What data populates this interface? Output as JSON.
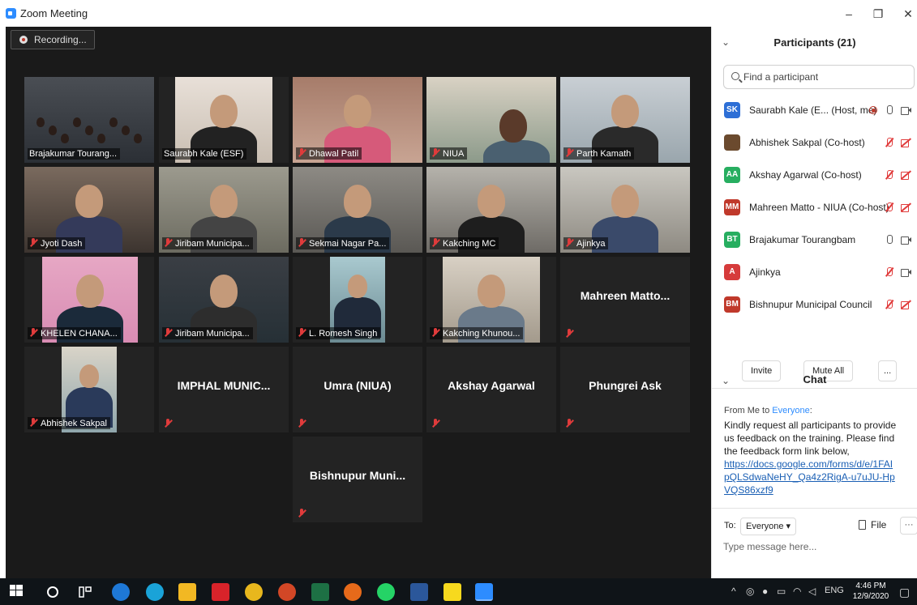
{
  "window": {
    "title": "Zoom Meeting",
    "minimize": "–",
    "restore": "❐",
    "close": "✕"
  },
  "recording_label": "Recording...",
  "tiles": [
    {
      "name": "Brajakumar Tourang...",
      "muted": false,
      "video": true
    },
    {
      "name": "Saurabh Kale (ESF)",
      "muted": false,
      "video": true
    },
    {
      "name": "Dhawal Patil",
      "muted": true,
      "video": true
    },
    {
      "name": "NIUA",
      "muted": true,
      "video": true
    },
    {
      "name": "Parth Kamath",
      "muted": true,
      "video": true
    },
    {
      "name": "Jyoti Dash",
      "muted": true,
      "video": true
    },
    {
      "name": "Jiribam Municipa...",
      "muted": true,
      "video": true
    },
    {
      "name": "Sekmai Nagar Pa...",
      "muted": true,
      "video": true
    },
    {
      "name": "Kakching MC",
      "muted": true,
      "video": true
    },
    {
      "name": "Ajinkya",
      "muted": true,
      "video": true
    },
    {
      "name": "KHELEN CHANA...",
      "muted": true,
      "video": true
    },
    {
      "name": "Jiribam Municipa...",
      "muted": true,
      "video": true
    },
    {
      "name": "L. Romesh Singh",
      "muted": true,
      "video": true
    },
    {
      "name": "Kakching Khunou...",
      "muted": true,
      "video": true
    },
    {
      "name": "Mahreen Matto...",
      "muted": true,
      "video": false
    },
    {
      "name": "Abhishek Sakpal",
      "muted": true,
      "video": true
    },
    {
      "name": "IMPHAL MUNIC...",
      "muted": true,
      "video": false
    },
    {
      "name": "Umra (NIUA)",
      "muted": true,
      "video": false
    },
    {
      "name": "Akshay Agarwal",
      "muted": true,
      "video": false
    },
    {
      "name": "Phungrei Ask",
      "muted": true,
      "video": false
    },
    {
      "name": "Bishnupur Muni...",
      "muted": true,
      "video": false
    }
  ],
  "participants_panel": {
    "title": "Participants (21)",
    "search_placeholder": "Find a participant",
    "participants": [
      {
        "initials": "SK",
        "color": "#2d6fd6",
        "name": "Saurabh Kale (E...  (Host, me)",
        "icons": [
          "rec",
          "mic",
          "cam"
        ]
      },
      {
        "initials": "",
        "color": "#6b4a2e",
        "name": "Abhishek Sakpal (Co-host)",
        "icons": [
          "mic-red",
          "cam-red"
        ]
      },
      {
        "initials": "AA",
        "color": "#27ae60",
        "name": "Akshay Agarwal (Co-host)",
        "icons": [
          "mic-red",
          "cam-red"
        ]
      },
      {
        "initials": "MM",
        "color": "#c0392b",
        "name": "Mahreen Matto - NIUA (Co-host)",
        "icons": [
          "mic-red",
          "cam-red"
        ]
      },
      {
        "initials": "BT",
        "color": "#27ae60",
        "name": "Brajakumar Tourangbam",
        "icons": [
          "mic",
          "cam"
        ]
      },
      {
        "initials": "A",
        "color": "#d63b3b",
        "name": "Ajinkya",
        "icons": [
          "mic-red",
          "cam"
        ]
      },
      {
        "initials": "BM",
        "color": "#c0392b",
        "name": "Bishnupur Municipal Council",
        "icons": [
          "mic-red",
          "cam-red"
        ]
      }
    ],
    "invite_label": "Invite",
    "mute_all_label": "Mute All",
    "more_label": "..."
  },
  "chat": {
    "title": "Chat",
    "from_prefix": "From Me to ",
    "from_to": "Everyone",
    "from_suffix": ":",
    "message": "Kindly request all participants to provide us feedback on the training. Please find the feedback form link below,",
    "link": "https://docs.google.com/forms/d/e/1FAIpQLSdwaNeHY_Qa4z2RigA-u7uJU-HpVQS86xzf9",
    "to_label": "To:",
    "to_value": "Everyone ▾",
    "file_label": "File",
    "more_label": "···",
    "input_placeholder": "Type message here..."
  },
  "taskbar": {
    "lang": "ENG",
    "time": "4:46 PM",
    "date": "12/9/2020"
  }
}
